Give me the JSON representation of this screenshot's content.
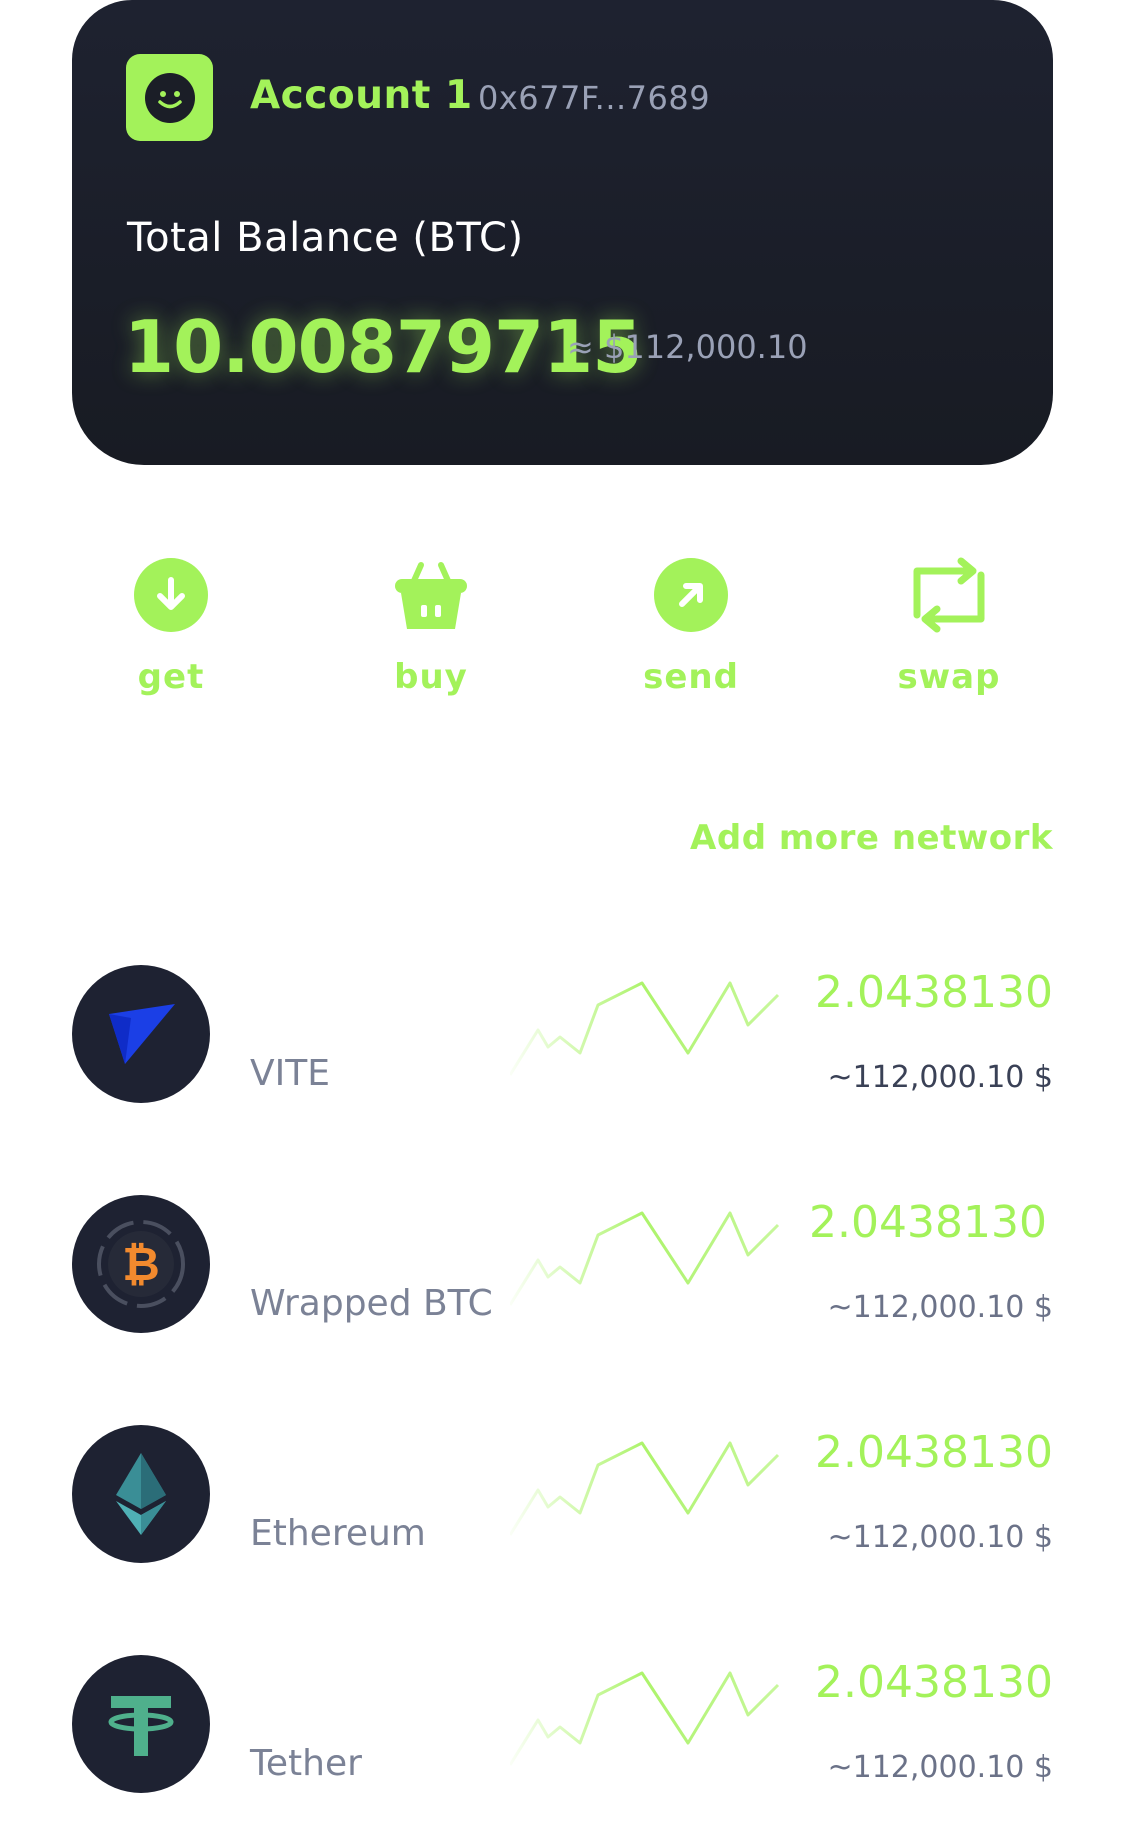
{
  "account": {
    "name": "Account 1",
    "address": "0x677F...7689",
    "balance_label": "Total Balance (BTC)",
    "balance_value": "10.00879715",
    "balance_usd": "≈ $112,000.10",
    "avatar_icon": "smiley-icon"
  },
  "actions": [
    {
      "label": "get",
      "icon": "download-icon"
    },
    {
      "label": "buy",
      "icon": "basket-icon"
    },
    {
      "label": "send",
      "icon": "arrow-up-right-icon"
    },
    {
      "label": "swap",
      "icon": "swap-icon"
    }
  ],
  "add_more_label": "Add more network",
  "tokens": [
    {
      "name": "VITE",
      "amount": "2.0438130",
      "usd": "~112,000.10 $",
      "icon": "vite-logo-icon"
    },
    {
      "name": "Wrapped BTC",
      "amount": "2.0438130",
      "usd": "~112,000.10 $",
      "icon": "bitcoin-logo-icon"
    },
    {
      "name": "Ethereum",
      "amount": "2.0438130",
      "usd": "~112,000.10 $",
      "icon": "ethereum-logo-icon"
    },
    {
      "name": "Tether",
      "amount": "2.0438130",
      "usd": "~112,000.10 $",
      "icon": "tether-logo-icon"
    }
  ],
  "colors": {
    "accent": "#a3f25a",
    "card_bg": "#1b1e27",
    "muted": "#9aa1b6"
  }
}
